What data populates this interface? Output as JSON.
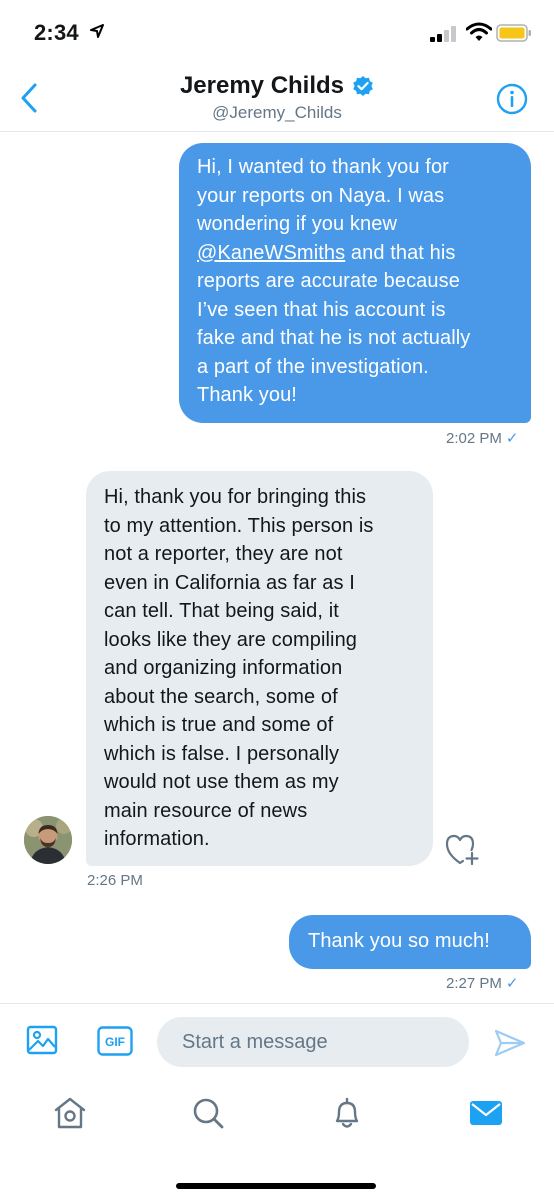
{
  "status_bar": {
    "time": "2:34",
    "icons": [
      "location-arrow-icon",
      "cellular-signal-icon",
      "wifi-icon",
      "battery-icon"
    ],
    "battery_color": "#f5c518"
  },
  "header": {
    "name": "Jeremy Childs",
    "handle": "@Jeremy_Childs",
    "verified": true,
    "accent_color": "#1da1f2"
  },
  "messages": [
    {
      "direction": "sent",
      "lines": [
        "Hi, I wanted to thank you for",
        "your reports on Naya. I was",
        "wondering if you knew",
        "@KaneWSmiths",
        " and that his",
        "reports are accurate because",
        "I’ve seen that his account is",
        "fake and that he is not actually",
        "a part of the investigation.",
        "Thank you!"
      ],
      "time": "2:02 PM",
      "read_check": "✓"
    },
    {
      "direction": "received",
      "lines": [
        "Hi, thank you for bringing this",
        "to my attention. This person is",
        "not a reporter, they are not",
        "even in California as far as I",
        "can tell. That being said, it",
        "looks like they are compiling",
        "and organizing information",
        "about the search, some of",
        "which is true and some of",
        "which is false. I personally",
        "would not use them as my",
        "main resource of news",
        "information."
      ],
      "time": "2:26 PM"
    },
    {
      "direction": "sent",
      "lines": [
        "Thank you so much!"
      ],
      "time": "2:27 PM",
      "read_check": "✓"
    }
  ],
  "composer": {
    "placeholder": "Start a message",
    "gif_label": "GIF"
  },
  "tabs": [
    "home-icon",
    "search-icon",
    "notifications-bell-icon",
    "messages-envelope-icon"
  ],
  "colors": {
    "sent_bubble": "#4a99e9",
    "received_bubble": "#e6ecf0",
    "secondary_text": "#657786"
  }
}
